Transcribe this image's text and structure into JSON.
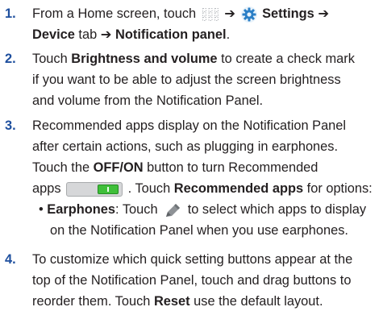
{
  "steps": [
    {
      "number": "1.",
      "lines": [
        {
          "a": "From a Home screen, touch ",
          "b": "➔",
          "c": "Settings ➔"
        },
        {
          "a": "Device",
          "b": " tab ",
          "c": "➔ Notification panel",
          "d": "."
        }
      ]
    },
    {
      "number": "2.",
      "lines": [
        {
          "a": "Touch ",
          "b": "Brightness and volume",
          "c": " to create a check mark"
        },
        {
          "a": "if you want to be able to adjust the screen brightness"
        },
        {
          "a": "and volume from the Notification Panel."
        }
      ]
    },
    {
      "number": "3.",
      "lines": [
        {
          "a": "Recommended apps display on the Notification Panel"
        },
        {
          "a": "after certain actions, such as plugging in earphones."
        },
        {
          "a": "Touch the ",
          "b": "OFF/ON",
          "c": " button to turn Recommended"
        },
        {
          "a": "apps ",
          "b": ". Touch ",
          "c": "Recommended apps",
          "d": " for options:"
        },
        {
          "a": "• ",
          "b": "Earphones",
          "c": ": Touch ",
          "d": " to select which apps to display"
        },
        {
          "a": "on the Notification Panel when you use earphones."
        }
      ]
    },
    {
      "number": "4.",
      "lines": [
        {
          "a": "To customize which quick setting buttons appear at the"
        },
        {
          "a": "top of the Notification Panel, touch and drag buttons to"
        },
        {
          "a": "reorder them. Touch ",
          "b": "Reset",
          "c": " use the default layout."
        }
      ]
    }
  ],
  "icons": {
    "apps": "apps-grid-icon",
    "settings": "gear-icon",
    "toggle": "on-off-toggle-icon",
    "edit": "pencil-icon"
  },
  "colors": {
    "step_number": "#1e4f9e",
    "text": "#231f20",
    "toggle_on": "#3fbf3a"
  }
}
